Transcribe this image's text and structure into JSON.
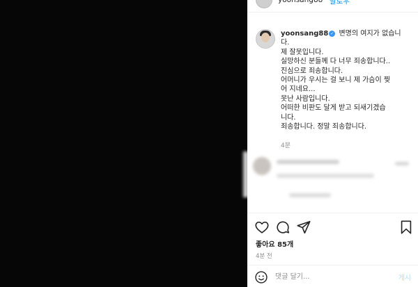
{
  "header": {
    "username": "yoonsang88",
    "follow_label": "팔로우",
    "more_glyph": "···"
  },
  "caption": {
    "username": "yoonsang88",
    "verified_glyph": "✓",
    "lines": [
      "변명의 여지가 없습니",
      "다.",
      "제 잘못입니다.",
      "실망하신 분들께 다 너무 죄송합니다..",
      "진심으로 죄송합니다.",
      "어머니가 우시는 걸 보니 제 가슴이 찢",
      "어 지네요...",
      "못난 사람입니다.",
      "어떠한 비판도 달게 받고 되새기겠습",
      "니다.",
      "죄송합니다. 정말 죄송합니다."
    ],
    "time": "4분"
  },
  "actions": {
    "icons": [
      "heart-icon",
      "comment-icon",
      "share-icon",
      "bookmark-icon"
    ],
    "likes": "좋아요 85개",
    "time": "4분 전"
  },
  "comment_box": {
    "placeholder": "댓글 달기...",
    "post_label": "게시"
  }
}
